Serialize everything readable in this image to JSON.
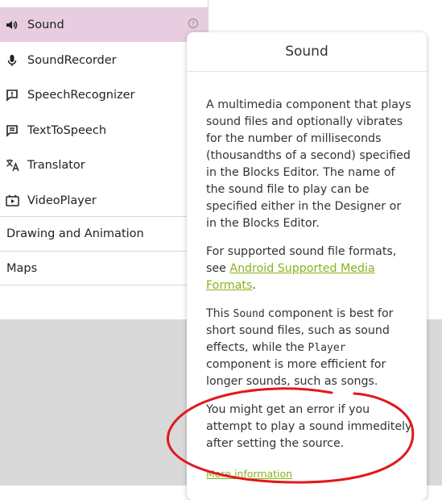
{
  "palette": {
    "items": [
      {
        "label": "Sound",
        "icon": "speaker-icon",
        "selected": true
      },
      {
        "label": "SoundRecorder",
        "icon": "microphone-icon"
      },
      {
        "label": "SpeechRecognizer",
        "icon": "speech-bubble-icon"
      },
      {
        "label": "TextToSpeech",
        "icon": "text-message-icon"
      },
      {
        "label": "Translator",
        "icon": "translate-icon"
      },
      {
        "label": "VideoPlayer",
        "icon": "video-play-icon"
      }
    ],
    "help_glyph": "?",
    "categories": [
      "Drawing and Animation",
      "Maps"
    ]
  },
  "popup": {
    "title": "Sound",
    "p1": "A multimedia component that plays sound files and optionally vibrates for the number of milliseconds (thousandths of a second) specified in the Blocks Editor. The name of the sound file to play can be specified either in the Designer or in the Blocks Editor.",
    "p2_prefix": "For supported sound file formats, see ",
    "p2_link": "Android Supported Media Formats",
    "p2_suffix": ".",
    "p3_a": "This ",
    "p3_code1": "Sound",
    "p3_b": " component is best for short sound files, such as sound effects, while the ",
    "p3_code2": "Player",
    "p3_c": " component is more efficient for longer sounds, such as songs.",
    "p4": "You might get an error if you attempt to play a sound immeditely after setting the source.",
    "more_link": "More information"
  },
  "colors": {
    "selected_bg": "#e8cde0",
    "link": "#8ab21a",
    "annotation": "#e0191c"
  }
}
